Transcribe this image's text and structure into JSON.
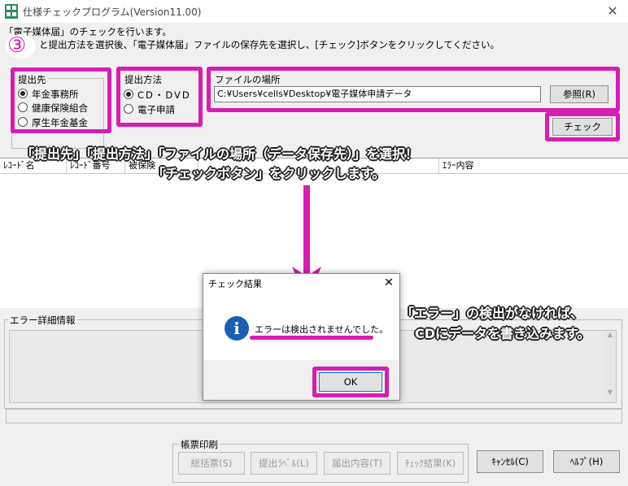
{
  "window": {
    "title": "仕様チェックプログラム(Version11.00)",
    "close_glyph": "✕"
  },
  "instructions": {
    "line1": "「電子媒体届」のチェックを行います。",
    "line2": "と提出方法を選択後、「電子媒体届」ファイルの保存先を選択し、[チェック]ボタンをクリックしてください。"
  },
  "step_badge": "③",
  "submit_to": {
    "label": "提出先",
    "options": [
      "年金事務所",
      "健康保険組合",
      "厚生年金基金"
    ],
    "selected": "年金事務所"
  },
  "submit_method": {
    "label": "提出方法",
    "options": [
      "CD・DVD",
      "電子申請"
    ],
    "selected": "CD・DVD"
  },
  "file_location": {
    "label": "ファイルの場所",
    "path": "C:¥Users¥cells¥Desktop¥電子媒体申請データ",
    "browse_label": "参照(R)"
  },
  "check_button_label": "チェック",
  "grid": {
    "columns": [
      "ﾚｺｰﾄﾞ名",
      "ﾚｺｰﾄﾞ番号",
      "被保険",
      "",
      "ｴﾗｰ内容"
    ]
  },
  "error_detail": {
    "label": "エラー詳細情報"
  },
  "print_section": {
    "label": "帳票印刷",
    "buttons": [
      "総括票(S)",
      "提出ﾗﾍﾞﾙ(L)",
      "届出内容(T)",
      "ﾁｪｯｸ結果(K)"
    ]
  },
  "bottom_buttons": {
    "cancel": "ｷｬﾝｾﾙ(C)",
    "help": "ﾍﾙﾌﾟ(H)"
  },
  "dialog": {
    "title": "チェック結果",
    "message": "エラーは検出されませんでした。",
    "ok_label": "OK",
    "close_glyph": "✕",
    "info_glyph": "i"
  },
  "annotations": {
    "line1": "「提出先」「提出方法」「ファイルの場所（データ保存先）」を選択！",
    "line2": "「チェックボタン」をクリックします。",
    "right1": "「エラー」の検出がなければ、",
    "right2": "CDにデータを書き込みます。"
  },
  "colors": {
    "highlight": "#d81cb4",
    "info_icon": "#1a5fb4"
  }
}
